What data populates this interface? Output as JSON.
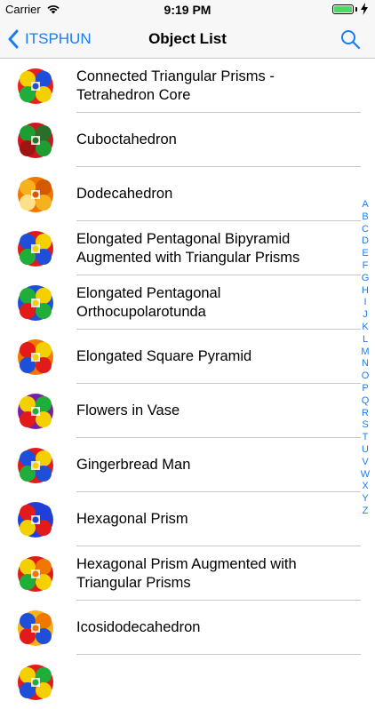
{
  "status_bar": {
    "carrier": "Carrier",
    "time": "9:19 PM"
  },
  "nav": {
    "back_label": "ITSPHUN",
    "title": "Object List"
  },
  "items": [
    {
      "label": "Connected Triangular Prisms - Tetrahedron Core",
      "colors": [
        "#e8201c",
        "#f5d000",
        "#1f4fd8",
        "#1fae3a"
      ]
    },
    {
      "label": "Cuboctahedron",
      "colors": [
        "#d2141e",
        "#1e9e32",
        "#2a6e2a",
        "#a01414"
      ]
    },
    {
      "label": "Dodecahedron",
      "colors": [
        "#f07800",
        "#f5b21e",
        "#d45a00",
        "#ffe08a"
      ]
    },
    {
      "label": "Elongated Pentagonal Bipyramid Augmented with Triangular Prisms",
      "colors": [
        "#e21a1a",
        "#1f4fd8",
        "#f5d000",
        "#1fae3a"
      ]
    },
    {
      "label": "Elongated Pentagonal Orthocupolarotunda",
      "colors": [
        "#1f4fd8",
        "#1fae3a",
        "#f5d000",
        "#e21a1a"
      ]
    },
    {
      "label": "Elongated Square Pyramid",
      "colors": [
        "#f07800",
        "#e21a1a",
        "#f5d000",
        "#1f4fd8"
      ]
    },
    {
      "label": "Flowers in Vase",
      "colors": [
        "#7a1fa0",
        "#f5d000",
        "#1fae3a",
        "#e21a1a"
      ]
    },
    {
      "label": "Gingerbread Man",
      "colors": [
        "#e21a1a",
        "#1f4fd8",
        "#f5d000",
        "#1fae3a"
      ]
    },
    {
      "label": "Hexagonal Prism",
      "colors": [
        "#1f3fd8",
        "#e21a1a",
        "#1f3fd8",
        "#f5d000"
      ]
    },
    {
      "label": "Hexagonal Prism Augmented with Triangular Prisms",
      "colors": [
        "#e21a1a",
        "#f5d000",
        "#f07800",
        "#1fae3a"
      ]
    },
    {
      "label": "Icosidodecahedron",
      "colors": [
        "#f5b21e",
        "#1f4fd8",
        "#f07800",
        "#e21a1a"
      ]
    },
    {
      "label": "",
      "colors": [
        "#e21a1a",
        "#f5d000",
        "#1fae3a",
        "#1f4fd8"
      ]
    }
  ],
  "index_letters": [
    "A",
    "B",
    "C",
    "D",
    "E",
    "F",
    "G",
    "H",
    "I",
    "J",
    "K",
    "L",
    "M",
    "N",
    "O",
    "P",
    "Q",
    "R",
    "S",
    "T",
    "U",
    "V",
    "W",
    "X",
    "Y",
    "Z"
  ],
  "theme": {
    "tint": "#1a7cf5",
    "battery": "#4cd964"
  }
}
